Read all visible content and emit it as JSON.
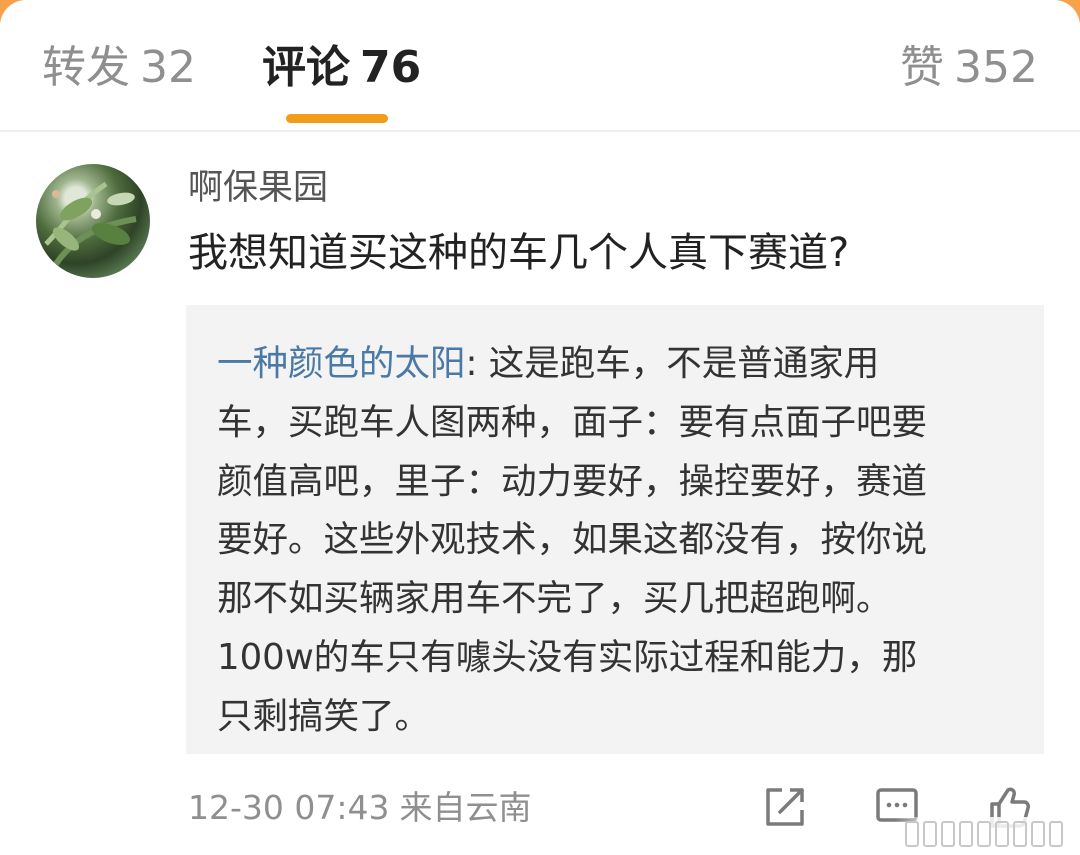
{
  "tabs": [
    {
      "label": "转发",
      "count": "32"
    },
    {
      "label": "评论",
      "count": "76"
    },
    {
      "label": "赞",
      "count": "352"
    }
  ],
  "colors": {
    "accent": "#f39c19",
    "link": "#4a79a5",
    "background_top": "#f7a14a"
  },
  "comment": {
    "username": "啊保果园",
    "text": "我想知道买这种的车几个人真下赛道?",
    "reply": {
      "author": "一种颜色的太阳",
      "separator": ":",
      "lines": [
        " 这是跑车，不是普通家用",
        "车，买跑车人图两种，面子：要有点面子吧要",
        "颜值高吧，里子：动力要好，操控要好，赛道",
        "要好。这些外观技术，如果这都没有，按你说",
        "那不如买辆家用车不完了，买几把超跑啊。",
        "100w的车只有噱头没有实际过程和能力，那",
        "只剩搞笑了。"
      ]
    },
    "timestamp": "12-30 07:43",
    "source": "来自云南",
    "actions": {
      "share": "share-icon",
      "comment": "comment-icon",
      "like": "thumbs-up-icon"
    }
  }
}
